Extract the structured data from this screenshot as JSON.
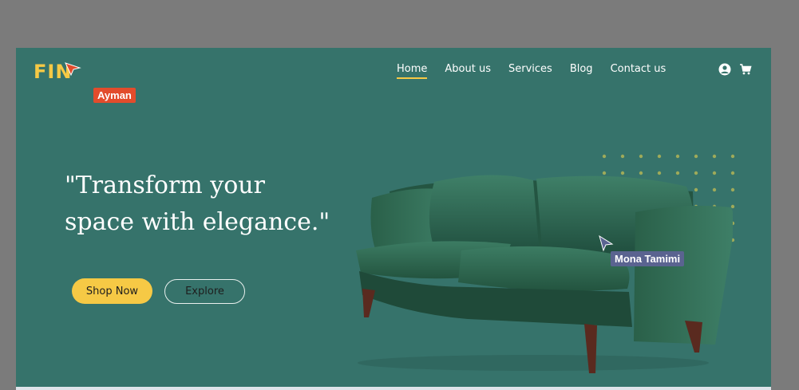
{
  "logo": {
    "text": "FIN",
    "collaborator": "Ayman"
  },
  "nav": {
    "items": [
      {
        "label": "Home",
        "active": true
      },
      {
        "label": "About us"
      },
      {
        "label": "Services"
      },
      {
        "label": "Blog"
      },
      {
        "label": "Contact us"
      }
    ],
    "icons": [
      "user-icon",
      "cart-icon"
    ]
  },
  "hero": {
    "headline_line1": "\"Transform your",
    "headline_line2": "space with elegance.\"",
    "primary_button": "Shop Now",
    "secondary_button": "Explore"
  },
  "cursor": {
    "name": "Mona Tamimi"
  },
  "colors": {
    "background": "#36736b",
    "accent": "#f6c945",
    "collab_tag": "#e24c2c",
    "cursor_tag": "#5a6390"
  }
}
